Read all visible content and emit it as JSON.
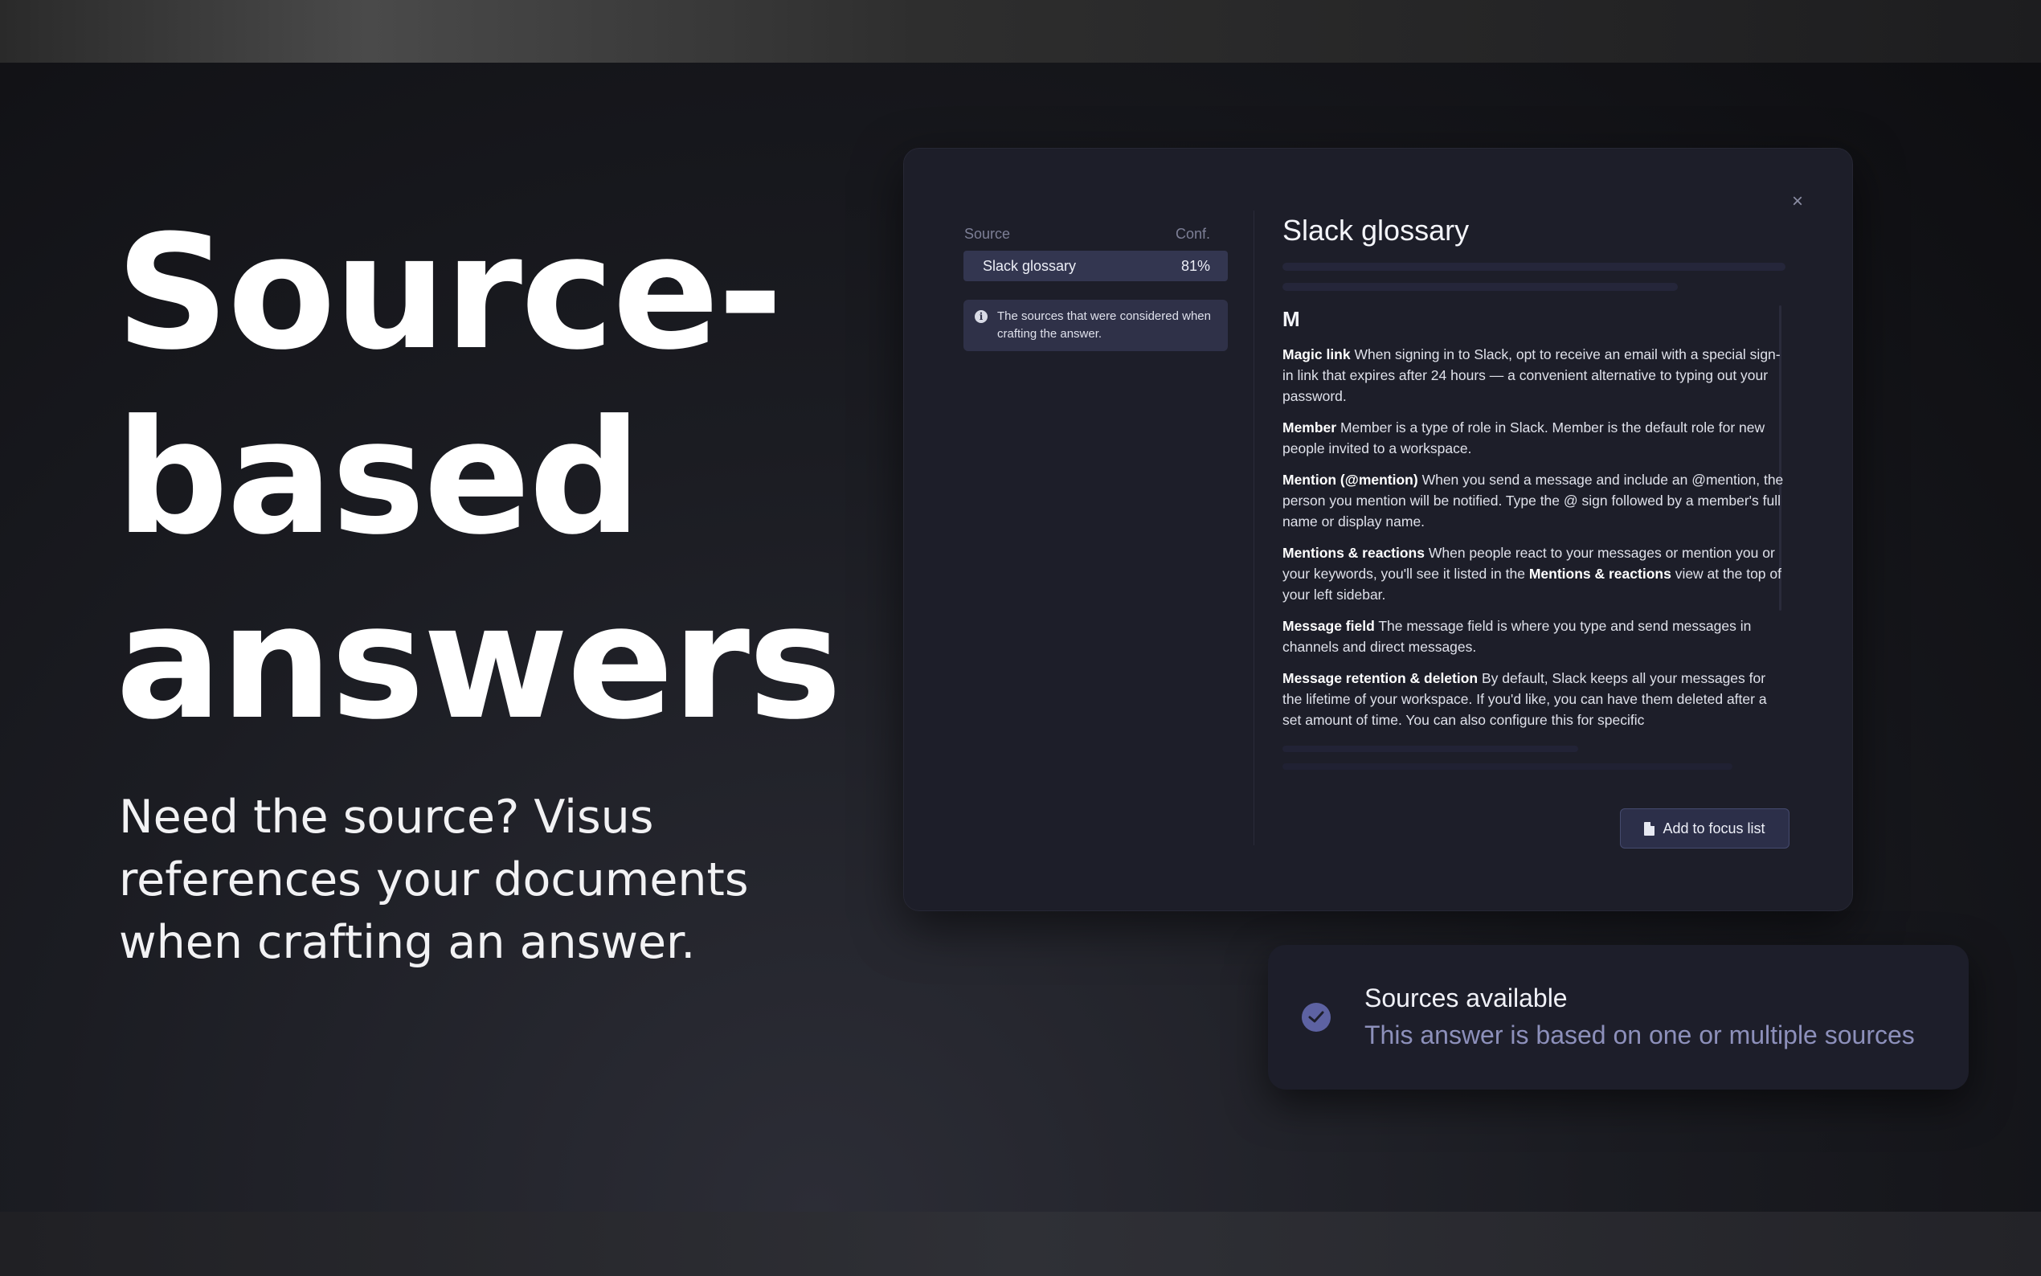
{
  "hero": {
    "headline_line1": "Source-",
    "headline_line2": "based",
    "headline_line3": "answers",
    "subcopy": "Need the source? Visus references your documents when crafting an answer."
  },
  "sources_panel": {
    "column_source": "Source",
    "column_conf": "Conf.",
    "rows": [
      {
        "name": "Slack glossary",
        "confidence": "81%"
      }
    ],
    "info_text": "The sources that were considered when crafting the answer."
  },
  "document": {
    "title": "Slack glossary",
    "section_letter": "M",
    "entries": [
      {
        "term": "Magic link",
        "definition": "When signing in to Slack, opt to receive an email with a special sign-in link that expires after 24 hours — a convenient alternative to typing out your password."
      },
      {
        "term": "Member",
        "definition": "Member is a type of role in Slack. Member is the default role for new people invited to a workspace."
      },
      {
        "term": "Mention (@mention)",
        "definition": "When you send a message and include an @mention, the person you mention will be notified. Type the @ sign followed by a member's full name or display name."
      },
      {
        "term": "Mentions & reactions",
        "definition_before": "When people react to your messages or mention you or your keywords, you'll see it listed in the",
        "definition_bold": "Mentions & reactions",
        "definition_after": "view at the top of your left sidebar."
      },
      {
        "term": "Message field",
        "definition": "The message field is where you type and send messages in channels and direct messages."
      },
      {
        "term": "Message retention & deletion",
        "definition": "By default, Slack keeps all your messages for the lifetime of your workspace. If you'd like, you can have them deleted after a set amount of time. You can also configure this for specific"
      }
    ],
    "add_button": "Add to focus list"
  },
  "toast": {
    "title": "Sources available",
    "subtitle": "This answer is based on one or multiple sources"
  },
  "icons": {
    "close": "close-icon",
    "info": "info-icon",
    "document": "document-icon",
    "check": "check-circle-icon"
  },
  "colors": {
    "panel_bg": "#1d1e29",
    "selected_row": "#333650",
    "accent": "#5d62a2",
    "toast_subtitle": "#8d90bb"
  }
}
